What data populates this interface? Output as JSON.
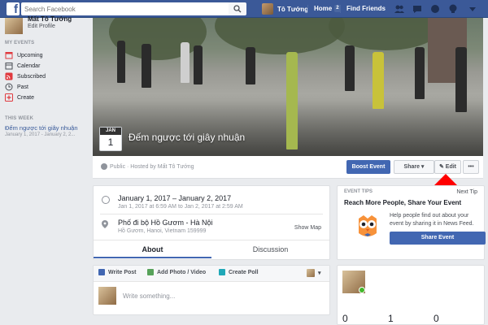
{
  "topbar": {
    "search_placeholder": "Search Facebook",
    "user_name": "Tô Tướng",
    "home_label": "Home",
    "home_badge": "2",
    "find_friends": "Find Friends"
  },
  "left": {
    "profile_name": "Mất Tô Tướng",
    "edit_profile": "Edit Profile",
    "my_events_header": "MY EVENTS",
    "items": [
      {
        "label": "Upcoming",
        "icon": "calendar-icon"
      },
      {
        "label": "Calendar",
        "icon": "calendar-grid-icon"
      },
      {
        "label": "Subscribed",
        "icon": "rss-icon"
      },
      {
        "label": "Past",
        "icon": "clock-icon"
      },
      {
        "label": "Create",
        "icon": "plus-icon"
      }
    ],
    "this_week_header": "THIS WEEK",
    "week_event_title": "Đếm ngược tới giây nhuận",
    "week_event_date": "January 1, 2017 - January 2, 2..."
  },
  "event": {
    "month": "JAN",
    "day": "1",
    "title": "Đếm ngược tới giây nhuận",
    "host_text": "Public · Hosted by Mất Tô Tướng",
    "boost_label": "Boost Event",
    "share_label": "Share ▾",
    "edit_label": "✎ Edit",
    "more_label": "•••"
  },
  "details": {
    "when_main": "January 1, 2017 – January 2, 2017",
    "when_sub": "Jan 1, 2017 at 6:59 AM to Jan 2, 2017 at 2:59 AM",
    "where_main": "Phố đi bộ Hồ Gươm - Hà Nội",
    "where_sub": "Hồ Gươm, Hanoi, Vietnam 159999",
    "show_map": "Show Map",
    "tab_about": "About",
    "tab_discussion": "Discussion"
  },
  "composer": {
    "write_post": "Write Post",
    "add_photo": "Add Photo / Video",
    "create_poll": "Create Poll",
    "placeholder": "Write something..."
  },
  "tips": {
    "header": "EVENT TIPS",
    "next_tip": "Next Tip",
    "title": "Reach More People, Share Your Event",
    "description": "Help people find out about your event by sharing it in News Feed.",
    "button": "Share Event"
  },
  "stats": [
    "0",
    "1",
    "0"
  ],
  "colors": {
    "brand": "#3b5998",
    "primary_button": "#4267b2",
    "highlight_arrow": "#ff0000"
  }
}
